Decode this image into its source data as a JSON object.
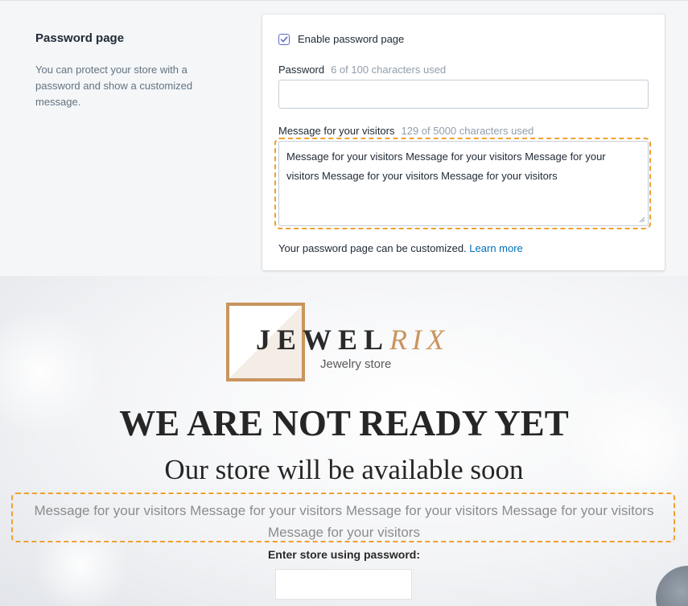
{
  "admin": {
    "section_title": "Password page",
    "section_description": "You can protect your store with a password and show a customized message.",
    "enable_label": "Enable password page",
    "enable_checked": true,
    "password_label": "Password",
    "password_hint": "6 of 100 characters used",
    "password_value": "",
    "message_label": "Message for your visitors",
    "message_hint": "129 of 5000 characters used",
    "message_value": "Message for your visitors Message for your visitors Message for your visitors Message for your visitors Message for your visitors",
    "custom_note": "Your password page can be customized.",
    "learn_more": "Learn more",
    "accent_color": "#5c6ac4",
    "link_color": "#006fbb",
    "highlight_color": "#f0a030"
  },
  "store": {
    "logo_dark": "JEWEL",
    "logo_accent": "RIX",
    "logo_sub": "Jewelry store",
    "headline": "WE ARE NOT READY YET",
    "subheadline": "Our store will be available soon",
    "visitor_message": "Message for your visitors Message for your visitors Message for your visitors Message for your visitors Message for your visitors",
    "enter_label": "Enter store using password:",
    "logo_color": "#c9955e"
  }
}
